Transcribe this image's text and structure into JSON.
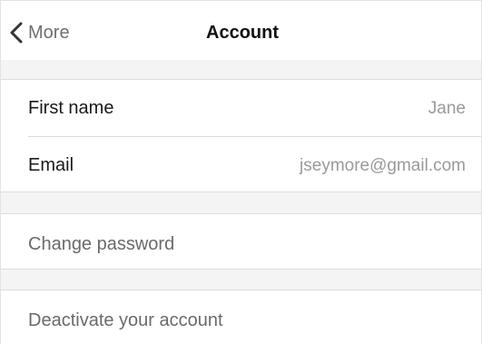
{
  "navbar": {
    "back_label": "More",
    "title": "Account"
  },
  "profile": {
    "first_name": {
      "label": "First name",
      "value": "Jane"
    },
    "email": {
      "label": "Email",
      "value": "jseymore@gmail.com"
    }
  },
  "actions": {
    "change_password": "Change password",
    "deactivate": "Deactivate your account"
  },
  "icons": {
    "back": "chevron-left-icon"
  },
  "colors": {
    "section_background": "#f4f4f4",
    "divider": "#dcdcdc",
    "value_text": "#9a9a9a"
  }
}
